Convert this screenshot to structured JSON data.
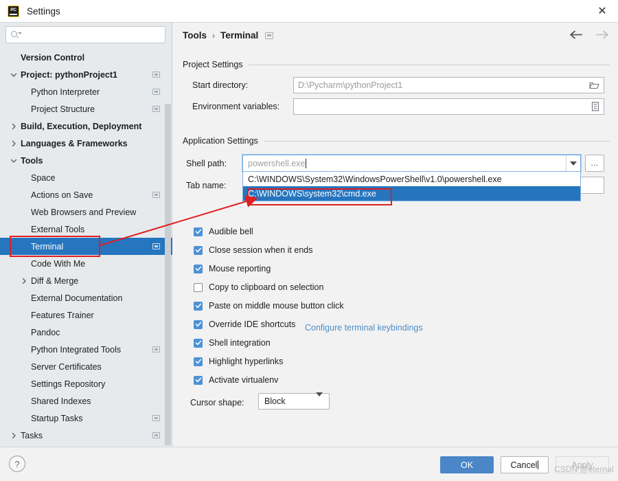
{
  "window": {
    "title": "Settings",
    "app_icon": "pycharm-icon",
    "close_icon": "close-icon"
  },
  "sidebar": {
    "search": {
      "placeholder": "",
      "value": "",
      "icon": "search-icon"
    },
    "items": [
      {
        "label": "Version Control",
        "indent": 30,
        "bold": true,
        "arrow": "",
        "badge": false,
        "selected": false
      },
      {
        "label": "Project: pythonProject1",
        "indent": 30,
        "bold": true,
        "arrow": "down",
        "badge": true,
        "selected": false
      },
      {
        "label": "Python Interpreter",
        "indent": 45,
        "bold": false,
        "arrow": "",
        "badge": true,
        "selected": false
      },
      {
        "label": "Project Structure",
        "indent": 45,
        "bold": false,
        "arrow": "",
        "badge": true,
        "selected": false
      },
      {
        "label": "Build, Execution, Deployment",
        "indent": 30,
        "bold": true,
        "arrow": "right",
        "badge": false,
        "selected": false
      },
      {
        "label": "Languages & Frameworks",
        "indent": 30,
        "bold": true,
        "arrow": "right",
        "badge": false,
        "selected": false
      },
      {
        "label": "Tools",
        "indent": 30,
        "bold": true,
        "arrow": "down",
        "badge": false,
        "selected": false
      },
      {
        "label": "Space",
        "indent": 45,
        "bold": false,
        "arrow": "",
        "badge": false,
        "selected": false
      },
      {
        "label": "Actions on Save",
        "indent": 45,
        "bold": false,
        "arrow": "",
        "badge": true,
        "selected": false
      },
      {
        "label": "Web Browsers and Preview",
        "indent": 45,
        "bold": false,
        "arrow": "",
        "badge": false,
        "selected": false
      },
      {
        "label": "External Tools",
        "indent": 45,
        "bold": false,
        "arrow": "",
        "badge": false,
        "selected": false
      },
      {
        "label": "Terminal",
        "indent": 45,
        "bold": false,
        "arrow": "",
        "badge": true,
        "selected": true
      },
      {
        "label": "Code With Me",
        "indent": 45,
        "bold": false,
        "arrow": "",
        "badge": false,
        "selected": false
      },
      {
        "label": "Diff & Merge",
        "indent": 45,
        "bold": false,
        "arrow": "right",
        "badge": false,
        "selected": false
      },
      {
        "label": "External Documentation",
        "indent": 45,
        "bold": false,
        "arrow": "",
        "badge": false,
        "selected": false
      },
      {
        "label": "Features Trainer",
        "indent": 45,
        "bold": false,
        "arrow": "",
        "badge": false,
        "selected": false
      },
      {
        "label": "Pandoc",
        "indent": 45,
        "bold": false,
        "arrow": "",
        "badge": false,
        "selected": false
      },
      {
        "label": "Python Integrated Tools",
        "indent": 45,
        "bold": false,
        "arrow": "",
        "badge": true,
        "selected": false
      },
      {
        "label": "Server Certificates",
        "indent": 45,
        "bold": false,
        "arrow": "",
        "badge": false,
        "selected": false
      },
      {
        "label": "Settings Repository",
        "indent": 45,
        "bold": false,
        "arrow": "",
        "badge": false,
        "selected": false
      },
      {
        "label": "Shared Indexes",
        "indent": 45,
        "bold": false,
        "arrow": "",
        "badge": false,
        "selected": false
      },
      {
        "label": "Startup Tasks",
        "indent": 45,
        "bold": false,
        "arrow": "",
        "badge": true,
        "selected": false
      },
      {
        "label": "Tasks",
        "indent": 30,
        "bold": false,
        "arrow": "right",
        "badge": true,
        "selected": false
      }
    ]
  },
  "main": {
    "breadcrumb": {
      "root": "Tools",
      "separator": "›",
      "leaf": "Terminal",
      "badge_icon": "copy-settings-icon"
    },
    "nav": {
      "back_icon": "arrow-left-icon",
      "forward_icon": "arrow-right-icon"
    },
    "project_settings": {
      "title": "Project Settings",
      "start_directory": {
        "label": "Start directory:",
        "value": "D:\\Pycharm\\pythonProject1",
        "icon": "folder-icon"
      },
      "environment_variables": {
        "label": "Environment variables:",
        "value": "",
        "icon": "list-edit-icon"
      }
    },
    "application_settings": {
      "title": "Application Settings",
      "shell_path": {
        "label": "Shell path:",
        "value": "powershell.exe",
        "dropdown_icon": "chevron-down-icon",
        "browse_label": "...",
        "options": [
          "C:\\WINDOWS\\System32\\WindowsPowerShell\\v1.0\\powershell.exe",
          "C:\\WINDOWS\\system32\\cmd.exe"
        ],
        "selected_index": 1
      },
      "tab_name": {
        "label": "Tab name:",
        "value": ""
      },
      "checkboxes": [
        {
          "label": "Audible bell",
          "checked": true
        },
        {
          "label": "Close session when it ends",
          "checked": true
        },
        {
          "label": "Mouse reporting",
          "checked": true
        },
        {
          "label": "Copy to clipboard on selection",
          "checked": false
        },
        {
          "label": "Paste on middle mouse button click",
          "checked": true
        },
        {
          "label": "Override IDE shortcuts",
          "checked": true
        },
        {
          "label": "Shell integration",
          "checked": true
        },
        {
          "label": "Highlight hyperlinks",
          "checked": true
        },
        {
          "label": "Activate virtualenv",
          "checked": true
        }
      ],
      "keybindings_link": "Configure terminal keybindings",
      "cursor_shape": {
        "label": "Cursor shape:",
        "value": "Block",
        "icon": "chevron-down-icon"
      }
    }
  },
  "footer": {
    "help_label": "?",
    "ok_label": "OK",
    "cancel_label": "Cancel",
    "apply_label": "Apply"
  },
  "watermark": "CSDN @eternal",
  "colors": {
    "accent": "#2675bf",
    "selection": "#2675bf",
    "checkbox": "#4c92d6",
    "primary_button": "#4a86c8",
    "link": "#4b8ec9",
    "annotation": "#e02020",
    "sidebar_bg": "#e6eaed",
    "panel_bg": "#f2f2f2"
  }
}
